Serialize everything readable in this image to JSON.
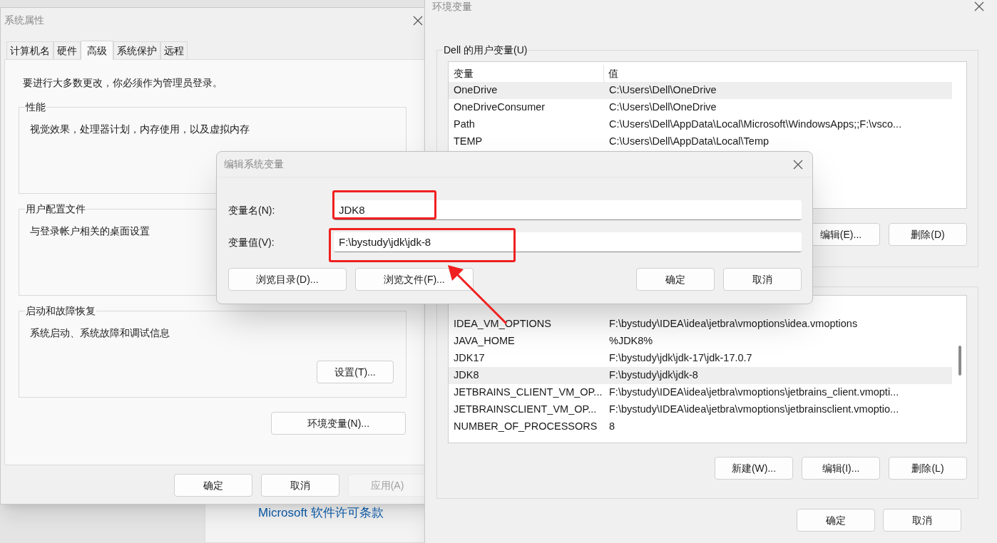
{
  "background": {
    "link": "Microsoft 软件许可条款"
  },
  "system_properties": {
    "title": "系统属性",
    "tabs": [
      {
        "label": "计算机名",
        "selected": false
      },
      {
        "label": "硬件",
        "selected": false
      },
      {
        "label": "高级",
        "selected": true
      },
      {
        "label": "系统保护",
        "selected": false
      },
      {
        "label": "远程",
        "selected": false
      }
    ],
    "admin_note": "要进行大多数更改，你必须作为管理员登录。",
    "groups": [
      {
        "title": "性能",
        "description": "视觉效果，处理器计划，内存使用，以及虚拟内存"
      },
      {
        "title": "用户配置文件",
        "description": "与登录帐户相关的桌面设置"
      },
      {
        "title": "启动和故障恢复",
        "description": "系统启动、系统故障和调试信息",
        "button": "设置(T)..."
      }
    ],
    "env_button": "环境变量(N)...",
    "buttons": [
      {
        "label": "确定",
        "disabled": false
      },
      {
        "label": "取消",
        "disabled": false
      },
      {
        "label": "应用(A)",
        "disabled": true
      }
    ]
  },
  "environment_variables": {
    "title": "环境变量",
    "user_group": {
      "title": "Dell 的用户变量(U)",
      "columns": [
        "变量",
        "值"
      ],
      "rows": [
        {
          "name": "OneDrive",
          "value": "C:\\Users\\Dell\\OneDrive",
          "selected": true
        },
        {
          "name": "OneDriveConsumer",
          "value": "C:\\Users\\Dell\\OneDrive",
          "selected": false
        },
        {
          "name": "Path",
          "value": "C:\\Users\\Dell\\AppData\\Local\\Microsoft\\WindowsApps;;F:\\vsco...",
          "selected": false
        },
        {
          "name": "TEMP",
          "value": "C:\\Users\\Dell\\AppData\\Local\\Temp",
          "selected": false
        }
      ],
      "buttons": [
        "编辑(E)...",
        "删除(D)"
      ]
    },
    "system_group": {
      "rows": [
        {
          "name": "IDEA_VM_OPTIONS",
          "value": "F:\\bystudy\\IDEA\\idea\\jetbra\\vmoptions\\idea.vmoptions",
          "selected": false
        },
        {
          "name": "JAVA_HOME",
          "value": "%JDK8%",
          "selected": false
        },
        {
          "name": "JDK17",
          "value": "F:\\bystudy\\jdk\\jdk-17\\jdk-17.0.7",
          "selected": false
        },
        {
          "name": "JDK8",
          "value": "F:\\bystudy\\jdk\\jdk-8",
          "selected": true
        },
        {
          "name": "JETBRAINS_CLIENT_VM_OP...",
          "value": "F:\\bystudy\\IDEA\\idea\\jetbra\\vmoptions\\jetbrains_client.vmopti...",
          "selected": false
        },
        {
          "name": "JETBRAINSCLIENT_VM_OP...",
          "value": "F:\\bystudy\\IDEA\\idea\\jetbra\\vmoptions\\jetbrainsclient.vmoptio...",
          "selected": false
        },
        {
          "name": "NUMBER_OF_PROCESSORS",
          "value": "8",
          "selected": false
        }
      ],
      "buttons": [
        "新建(W)...",
        "编辑(I)...",
        "删除(L)"
      ]
    },
    "buttons": [
      "确定",
      "取消"
    ]
  },
  "edit_dialog": {
    "title": "编辑系统变量",
    "fields": [
      {
        "label": "变量名(N):",
        "value": "JDK8"
      },
      {
        "label": "变量值(V):",
        "value": "F:\\bystudy\\jdk\\jdk-8"
      }
    ],
    "browse_buttons": [
      "浏览目录(D)...",
      "浏览文件(F)..."
    ],
    "buttons": [
      "确定",
      "取消"
    ]
  }
}
